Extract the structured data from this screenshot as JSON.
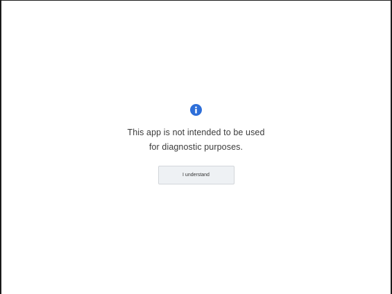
{
  "notice": {
    "icon": "info-icon",
    "icon_color": "#2e6fd9",
    "message_line_1": "This app is not intended to be used",
    "message_line_2": "for diagnostic purposes.",
    "button_label": "I understand"
  }
}
